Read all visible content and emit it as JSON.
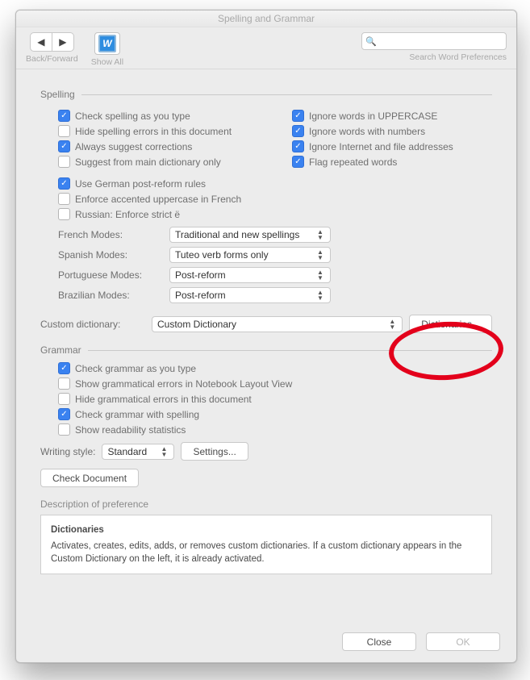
{
  "window": {
    "title": "Spelling and Grammar"
  },
  "toolbar": {
    "back_forward_label": "Back/Forward",
    "show_all_label": "Show All",
    "search_placeholder": "Search Word Preferences",
    "search_glyph": "🔍"
  },
  "spelling": {
    "heading": "Spelling",
    "left": [
      {
        "checked": true,
        "label": "Check spelling as you type"
      },
      {
        "checked": false,
        "label": "Hide spelling errors in this document"
      },
      {
        "checked": true,
        "label": "Always suggest corrections"
      },
      {
        "checked": false,
        "label": "Suggest from main dictionary only"
      }
    ],
    "right": [
      {
        "checked": true,
        "label": "Ignore words in UPPERCASE"
      },
      {
        "checked": true,
        "label": "Ignore words with numbers"
      },
      {
        "checked": true,
        "label": "Ignore Internet and file addresses"
      },
      {
        "checked": true,
        "label": "Flag repeated words"
      }
    ],
    "lang": [
      {
        "checked": true,
        "label": "Use German post-reform rules"
      },
      {
        "checked": false,
        "label": "Enforce accented uppercase in French"
      },
      {
        "checked": false,
        "label": "Russian: Enforce strict ё"
      }
    ],
    "modes": [
      {
        "label": "French Modes:",
        "value": "Traditional and new spellings"
      },
      {
        "label": "Spanish Modes:",
        "value": "Tuteo verb forms only"
      },
      {
        "label": "Portuguese Modes:",
        "value": "Post-reform"
      },
      {
        "label": "Brazilian Modes:",
        "value": "Post-reform"
      }
    ],
    "custom": {
      "label": "Custom dictionary:",
      "value": "Custom Dictionary",
      "button": "Dictionaries..."
    }
  },
  "grammar": {
    "heading": "Grammar",
    "items": [
      {
        "checked": true,
        "label": "Check grammar as you type"
      },
      {
        "checked": false,
        "label": "Show grammatical errors in Notebook Layout View"
      },
      {
        "checked": false,
        "label": "Hide grammatical errors in this document"
      },
      {
        "checked": true,
        "label": "Check grammar with spelling"
      },
      {
        "checked": false,
        "label": "Show readability statistics"
      }
    ],
    "writing_label": "Writing style:",
    "writing_value": "Standard",
    "settings_button": "Settings...",
    "check_doc": "Check Document"
  },
  "desc": {
    "heading": "Description of preference",
    "title": "Dictionaries",
    "body": "Activates, creates, edits, adds, or removes custom dictionaries. If a custom dictionary appears in the Custom Dictionary on the left, it is already activated."
  },
  "footer": {
    "close": "Close",
    "ok": "OK"
  }
}
